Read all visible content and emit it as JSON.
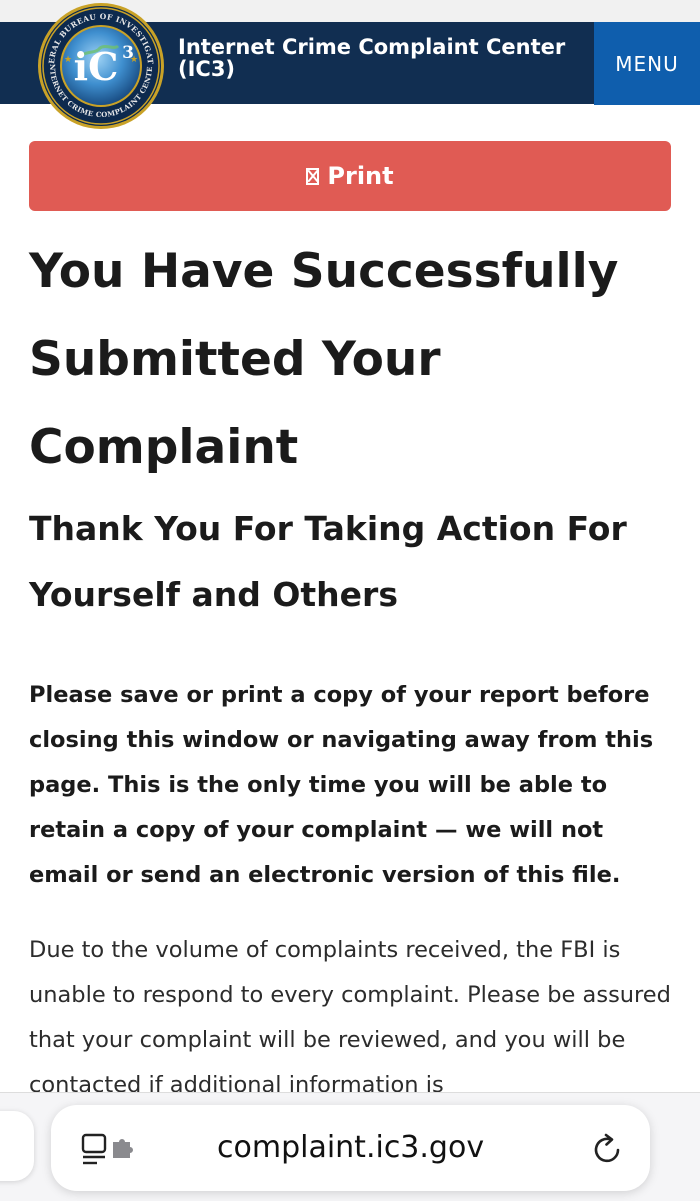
{
  "header": {
    "site_title": "Internet Crime Complaint Center (IC3)",
    "menu_label": "MENU",
    "seal": {
      "top_arc_text": "FEDERAL BUREAU OF INVESTIGATION",
      "bottom_arc_text": "INTERNET CRIME COMPLAINT CENTER",
      "center_text": "iC",
      "superscript": "3"
    }
  },
  "print_button": {
    "icon": "missing-glyph-icon",
    "label": "Print"
  },
  "main": {
    "title": "You Have Successfully Submitted Your Complaint",
    "subtitle": "Thank You For Taking Action For Yourself and Others",
    "notice": "Please save or print a copy of your report before closing this window or navigating away from this page. This is the only time you will be able to retain a copy of your complaint — we will not email or send an electronic version of this file.",
    "body": "Due to the volume of complaints received, the FBI is unable to respond to every complaint. Please be assured that your complaint will be reviewed, and you will be contacted if additional information is"
  },
  "browser": {
    "url": "complaint.ic3.gov",
    "left_icon": "reader-extension-icon",
    "right_icon": "reload-icon"
  },
  "colors": {
    "header_bg": "#112e51",
    "menu_bg": "#0f5ead",
    "print_bg": "#e05b54"
  }
}
